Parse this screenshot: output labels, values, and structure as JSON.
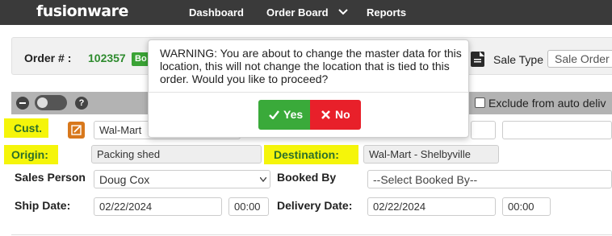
{
  "nav": {
    "logo": "fusionware",
    "items": [
      "Dashboard",
      "Order Board",
      "Reports"
    ]
  },
  "order": {
    "label": "Order # :",
    "number": "102357",
    "badge": "Bo",
    "sale_type_label": "Sale Type",
    "sale_type_value": "Sale Order"
  },
  "toolbar": {
    "exclude_label": "Exclude from auto deliv"
  },
  "form": {
    "cust_label": "Cust.",
    "cust_value": "Wal-Mart",
    "origin_label": "Origin:",
    "origin_value": "Packing shed",
    "destination_label": "Destination:",
    "destination_value": "Wal-Mart - Shelbyville",
    "sales_person_label": "Sales Person",
    "sales_person_value": "Doug Cox",
    "booked_by_label": "Booked By",
    "booked_by_placeholder": "--Select Booked By--",
    "ship_date_label": "Ship Date:",
    "ship_date_value": "02/22/2024",
    "ship_time_value": "00:00",
    "delivery_date_label": "Delivery Date:",
    "delivery_date_value": "02/22/2024",
    "delivery_time_value": "00:00"
  },
  "modal": {
    "message": "WARNING: You are about to change the master data for this location, this will not change the location that is tied to this order. Would you like to proceed?",
    "yes_label": "Yes",
    "no_label": "No"
  },
  "colors": {
    "highlight": "#f5f50a",
    "label_green": "#2b6f2b",
    "yes_green": "#3aaa3a",
    "no_red": "#e8202a",
    "nav_bg": "#3a3a3a"
  }
}
